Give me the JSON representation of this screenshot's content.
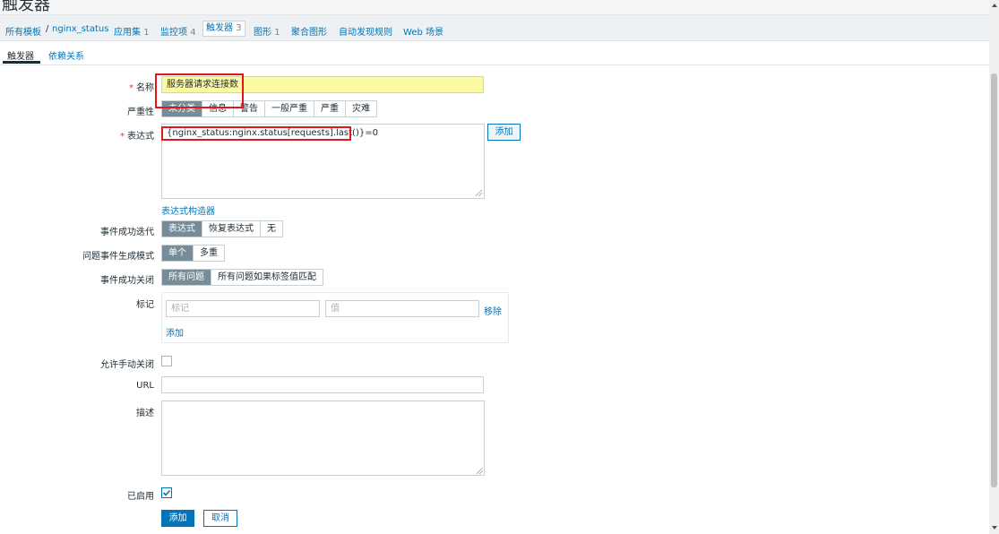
{
  "page_title": "触发器",
  "breadcrumb": {
    "all_templates": "所有模板",
    "sep": "/",
    "template": "nginx_status",
    "app_label": "应用集",
    "app_count": "1",
    "items_label": "监控项",
    "items_count": "4",
    "triggers_label": "触发器",
    "triggers_count": "3",
    "graphs_label": "图形",
    "graphs_count": "1",
    "screens_label": "聚合图形",
    "discovery_label": "自动发现规则",
    "web_label": "Web 场景"
  },
  "tabs": {
    "trigger": "触发器",
    "dependencies": "依赖关系"
  },
  "form": {
    "name_label": "名称",
    "name_value": "服务器请求连接数",
    "severity_label": "严重性",
    "severity_options": [
      "未分类",
      "信息",
      "警告",
      "一般严重",
      "严重",
      "灾难"
    ],
    "severity_selected": "未分类",
    "expression_label": "表达式",
    "expression_value": "{nginx_status:nginx.status[requests].last()}=0",
    "add_expression_button": "添加",
    "expression_builder_link": "表达式构造器",
    "ok_event_gen_label": "事件成功迭代",
    "ok_event_gen_options": [
      "表达式",
      "恢复表达式",
      "无"
    ],
    "ok_event_gen_selected": "表达式",
    "problem_mode_label": "问题事件生成模式",
    "problem_mode_options": [
      "单个",
      "多重"
    ],
    "problem_mode_selected": "单个",
    "ok_close_label": "事件成功关闭",
    "ok_close_options": [
      "所有问题",
      "所有问题如果标签值匹配"
    ],
    "ok_close_selected": "所有问题",
    "tags_label": "标记",
    "tag_name_placeholder": "标记",
    "tag_value_placeholder": "值",
    "tag_remove_link": "移除",
    "tag_add_link": "添加",
    "manual_close_label": "允许手动关闭",
    "manual_close_checked": false,
    "url_label": "URL",
    "url_value": "",
    "description_label": "描述",
    "description_value": "",
    "enabled_label": "已启用",
    "enabled_checked": true,
    "submit_button": "添加",
    "cancel_button": "取消"
  },
  "colors": {
    "accent": "#0275b8",
    "selected_segment": "#768d99",
    "name_field_bg": "#fbf9a2",
    "annotation_red": "#e0171b"
  }
}
